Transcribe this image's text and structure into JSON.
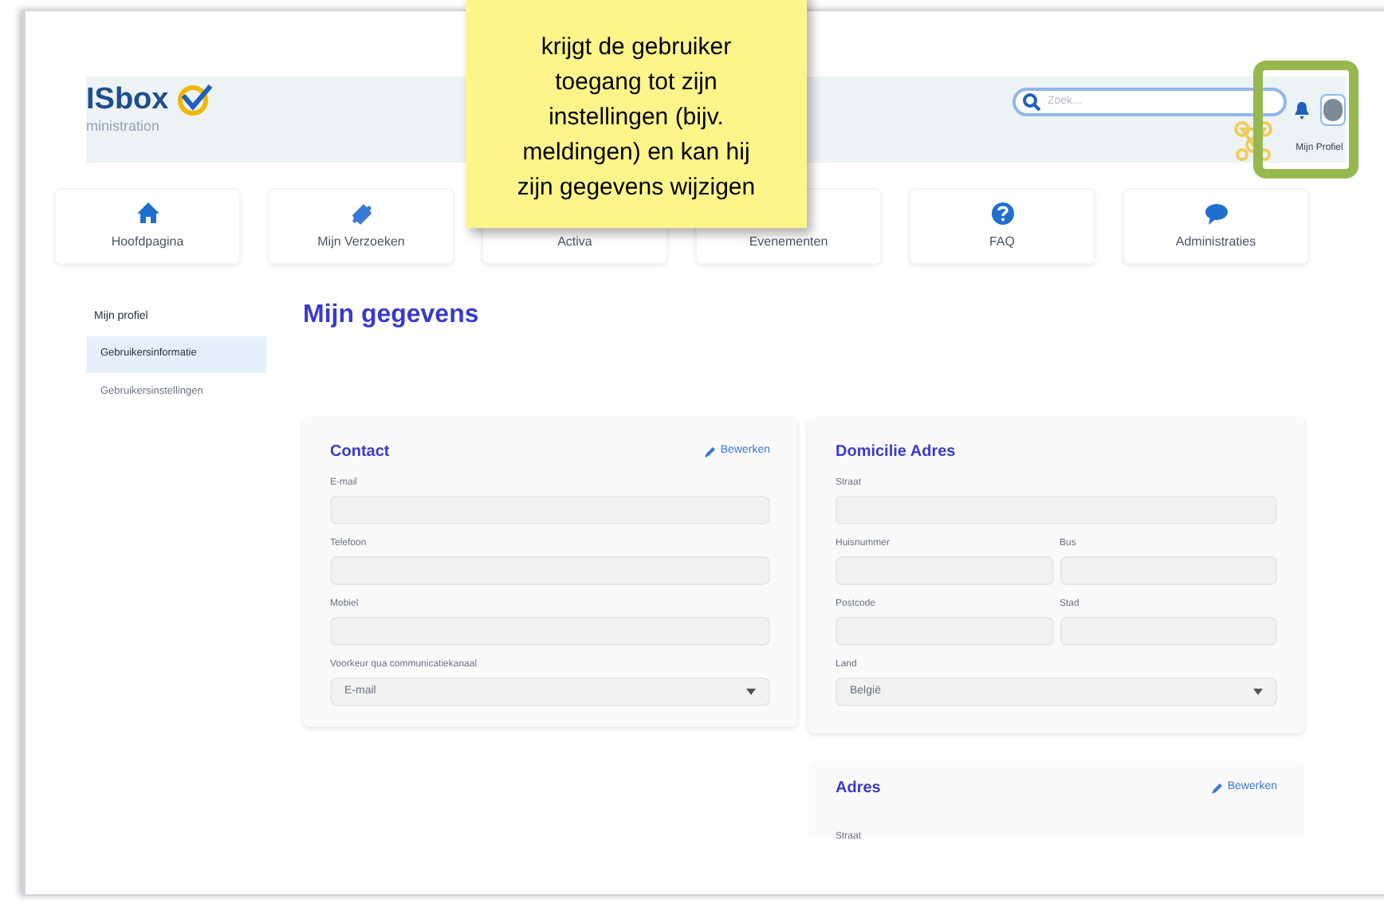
{
  "note": {
    "lines": [
      "krijgt de gebruiker",
      "toegang tot zijn",
      "instellingen (bijv.",
      "meldingen) en kan hij",
      "zijn gegevens wijzigen"
    ]
  },
  "header": {
    "logo": "ISbox",
    "subtitle": "ministration",
    "search": {
      "placeholder": "Zoek..."
    },
    "profile_label": "Mijn Profiel"
  },
  "nav": [
    {
      "label": "Hoofdpagina"
    },
    {
      "label": "Mijn Verzoeken"
    },
    {
      "label": "Activa"
    },
    {
      "label": "Evenementen"
    },
    {
      "label": "FAQ"
    },
    {
      "label": "Administraties"
    }
  ],
  "sidebar": {
    "title": "Mijn profiel",
    "items": [
      {
        "label": "Gebruikersinformatie",
        "selected": true
      },
      {
        "label": "Gebruikersinstellingen",
        "selected": false
      }
    ]
  },
  "page_title": "Mijn gegevens",
  "contact": {
    "title": "Contact",
    "edit": "Bewerken",
    "fields": [
      {
        "label": "E-mail",
        "kind": "text"
      },
      {
        "label": "Telefoon",
        "kind": "text"
      },
      {
        "label": "Mobiel",
        "kind": "text"
      },
      {
        "label": "Voorkeur qua communicatiekanaal",
        "kind": "select",
        "value": "E-mail"
      }
    ]
  },
  "domicile": {
    "title": "Domicilie Adres",
    "rows": [
      [
        {
          "label": "Straat",
          "kind": "text"
        }
      ],
      [
        {
          "label": "Huisnummer",
          "kind": "text"
        },
        {
          "label": "Bus",
          "kind": "text"
        }
      ],
      [
        {
          "label": "Postcode",
          "kind": "text"
        },
        {
          "label": "Stad",
          "kind": "text"
        }
      ],
      [
        {
          "label": "Land",
          "kind": "select",
          "value": "België"
        }
      ]
    ]
  },
  "address": {
    "title": "Adres",
    "edit": "Bewerken",
    "fields": [
      {
        "label": "Straat"
      }
    ]
  }
}
